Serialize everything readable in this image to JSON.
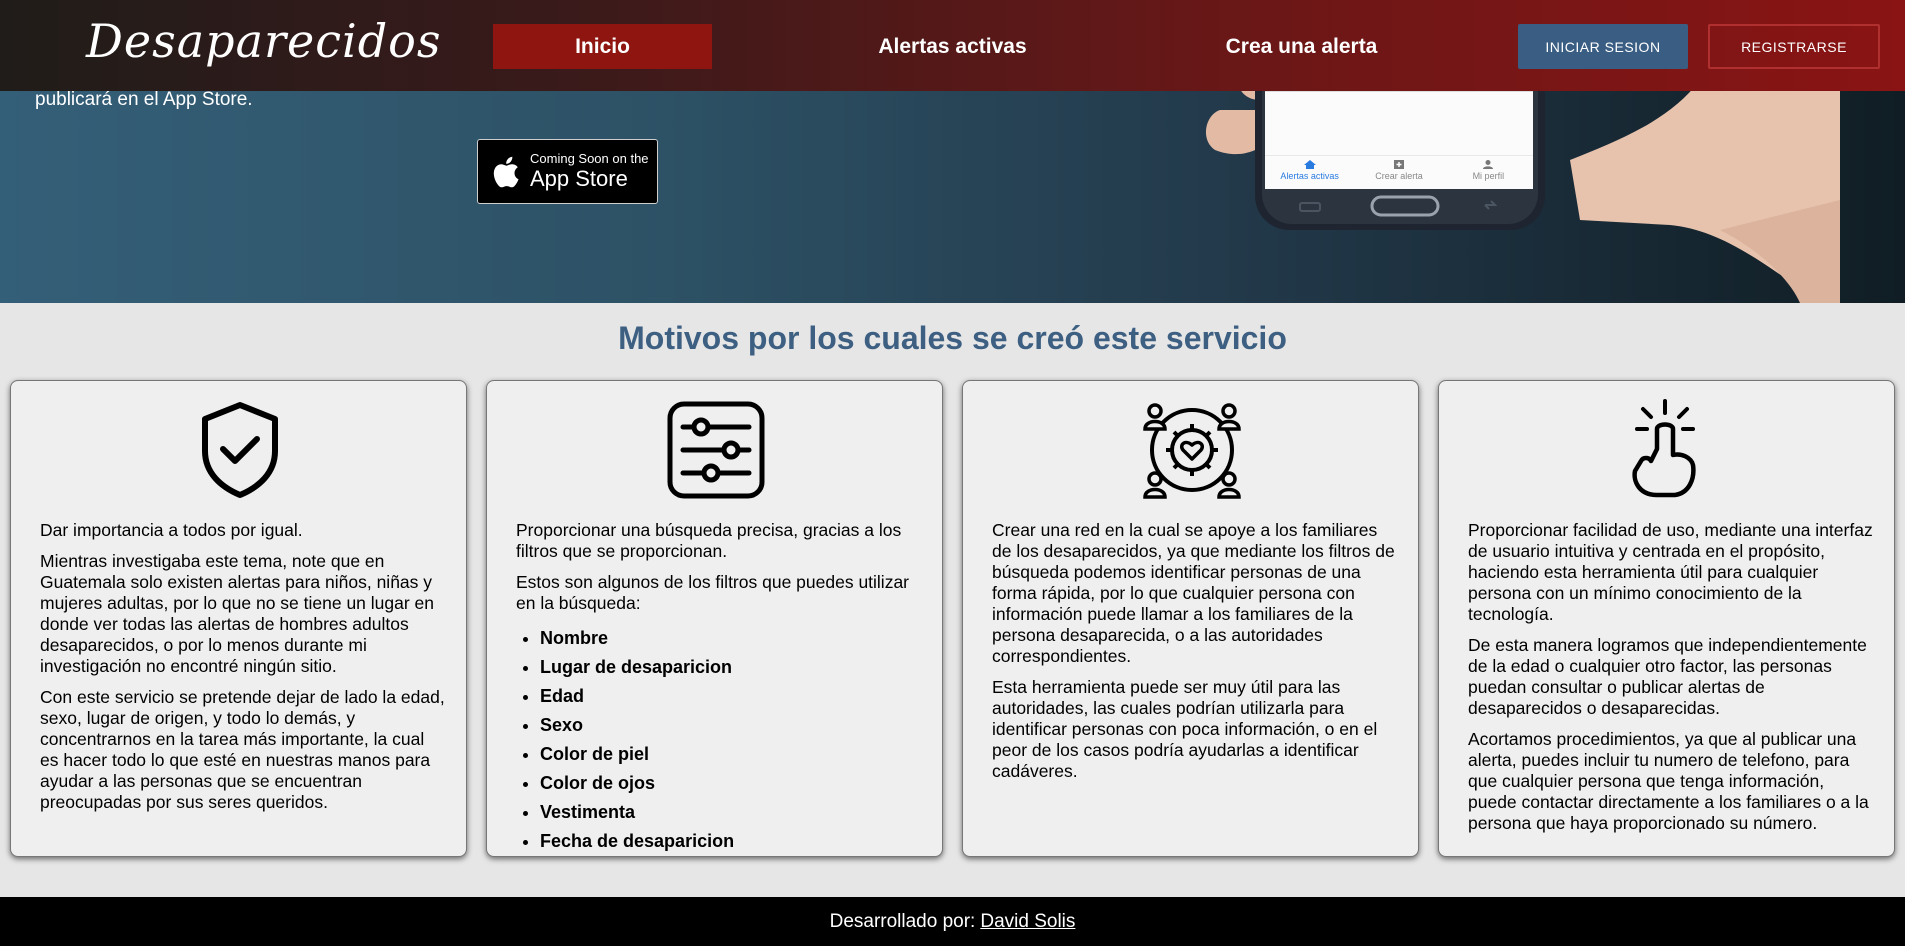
{
  "navbar": {
    "brand": "Desaparecidos",
    "links": [
      {
        "label": "Inicio"
      },
      {
        "label": "Alertas activas"
      },
      {
        "label": "Crea una alerta"
      }
    ],
    "login_label": "INICIAR SESION",
    "register_label": "REGISTRARSE"
  },
  "hero": {
    "text": "publicará en el App Store.",
    "badge_small": "Coming Soon on the",
    "badge_big": "App Store",
    "phone_tabs": [
      "Alertas activas",
      "Crear alerta",
      "Mi perfil"
    ]
  },
  "section": {
    "title": "Motivos por los cuales se creó este servicio"
  },
  "cards": [
    {
      "icon": "shield-check-icon",
      "paragraphs": [
        "Dar importancia a todos por igual.",
        "Mientras investigaba este tema, note que en Guatemala solo existen alertas para niños, niñas y mujeres adultas, por lo que no se tiene un lugar en donde ver todas las alertas de hombres adultos desaparecidos, o por lo menos durante mi investigación no encontré ningún sitio.",
        "Con este servicio se pretende dejar de lado la edad, sexo, lugar de origen, y todo lo demás, y concentrarnos en la tarea más importante, la cual es hacer todo lo que esté en nuestras manos para ayudar a las personas que se encuentran preocupadas por sus seres queridos."
      ]
    },
    {
      "icon": "filter-sliders-icon",
      "paragraphs": [
        "Proporcionar una búsqueda precisa, gracias a los filtros que se proporcionan.",
        "Estos son algunos de los filtros que puedes utilizar en la búsqueda:"
      ],
      "list": [
        "Nombre",
        "Lugar de desaparicion",
        "Edad",
        "Sexo",
        "Color de piel",
        "Color de ojos",
        "Vestimenta",
        "Fecha de desaparicion"
      ]
    },
    {
      "icon": "community-network-icon",
      "paragraphs": [
        "Crear una red en la cual se apoye a los familiares de los desaparecidos, ya que mediante los filtros de búsqueda podemos identificar personas de una forma rápida, por lo que cualquier persona con información puede llamar a los familiares de la persona desaparecida, o a las autoridades correspondientes.",
        "Esta herramienta puede ser muy útil para las autoridades, las cuales podrían utilizarla para identificar personas con poca información, o en el peor de los casos podría ayudarlas a identificar cadáveres."
      ]
    },
    {
      "icon": "touch-hand-icon",
      "paragraphs": [
        "Proporcionar facilidad de uso, mediante una interfaz de usuario intuitiva y centrada en el propósito, haciendo esta herramienta útil para cualquier persona con un mínimo conocimiento de la tecnología.",
        "De esta manera logramos que independientemente de la edad o cualquier otro factor, las personas puedan consultar o publicar alertas de desaparecidos o desaparecidas.",
        "Acortamos procedimientos, ya que al publicar una alerta, puedes incluir tu numero de telefono, para que cualquier persona que tenga información, puede contactar directamente a los familiares o a la persona que haya proporcionado su número."
      ]
    }
  ],
  "footer": {
    "prefix": "Desarrollado por:",
    "author": "David Solis"
  }
}
